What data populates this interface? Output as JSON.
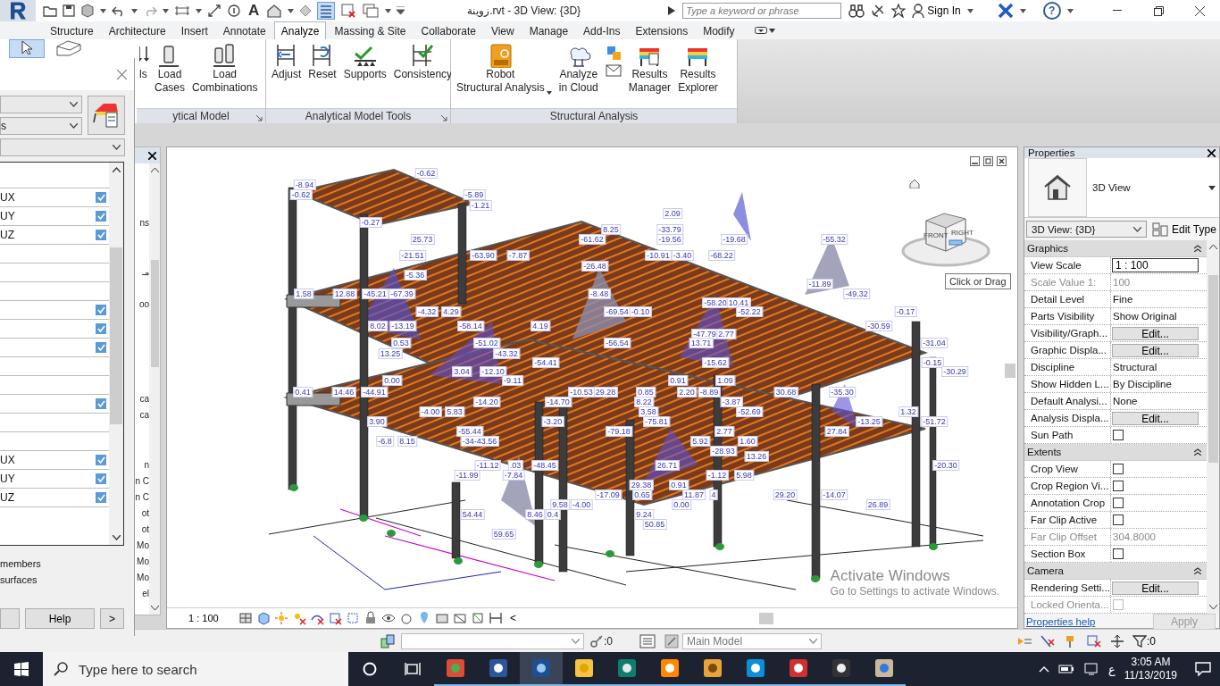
{
  "title_bar": {
    "text_tool": "A",
    "title": "زوينة.rvt - 3D View: {3D}",
    "search": {
      "placeholder": "Type a keyword or phrase"
    },
    "sign_in": "Sign In",
    "help": "?"
  },
  "tabs": [
    {
      "label": "Structure",
      "selected": false
    },
    {
      "label": "Architecture",
      "selected": false
    },
    {
      "label": "Insert",
      "selected": false
    },
    {
      "label": "Annotate",
      "selected": false
    },
    {
      "label": "Analyze",
      "selected": true
    },
    {
      "label": "Massing & Site",
      "selected": false
    },
    {
      "label": "Collaborate",
      "selected": false
    },
    {
      "label": "View",
      "selected": false
    },
    {
      "label": "Manage",
      "selected": false
    },
    {
      "label": "Add-Ins",
      "selected": false
    },
    {
      "label": "Extensions",
      "selected": false
    },
    {
      "label": "Modify",
      "selected": false
    }
  ],
  "ribbon": {
    "groups": [
      {
        "label": "ytical Model",
        "buttons": [
          {
            "kind": "loads",
            "label": "ls"
          },
          {
            "kind": "load-cases",
            "label": "Load\nCases"
          },
          {
            "kind": "load-combinations",
            "label": "Load\nCombinations"
          }
        ]
      },
      {
        "label": "Analytical Model Tools",
        "buttons": [
          {
            "kind": "adjust",
            "label": "Adjust"
          },
          {
            "kind": "reset",
            "label": "Reset"
          },
          {
            "kind": "supports",
            "label": "Supports"
          },
          {
            "kind": "consistency",
            "label": "Consistency"
          }
        ]
      },
      {
        "label": "Structural Analysis",
        "buttons": [
          {
            "kind": "robot",
            "label": "Robot\nStructural Analysis"
          },
          {
            "kind": "cloud",
            "label": "Analyze\nin Cloud"
          },
          {
            "kind": "mini"
          },
          {
            "kind": "results-manager",
            "label": "Results\nManager"
          },
          {
            "kind": "results-explorer",
            "label": "Results\nExplorer"
          }
        ]
      }
    ]
  },
  "dialog": {
    "dropdown_2": "s",
    "rows": [
      {
        "kind": "plain"
      },
      {
        "kind": "check",
        "label": "UX",
        "checked": true
      },
      {
        "kind": "check",
        "label": "UY",
        "checked": true
      },
      {
        "kind": "check",
        "label": "UZ",
        "checked": true
      },
      {
        "kind": "plain"
      },
      {
        "kind": "plain"
      },
      {
        "kind": "plain"
      },
      {
        "kind": "check",
        "checked": true
      },
      {
        "kind": "check",
        "checked": true
      },
      {
        "kind": "check",
        "checked": true
      },
      {
        "kind": "plain"
      },
      {
        "kind": "plain"
      },
      {
        "kind": "check",
        "checked": true
      },
      {
        "kind": "plain"
      },
      {
        "kind": "plain"
      },
      {
        "kind": "check",
        "label": "UX",
        "checked": true
      },
      {
        "kind": "check",
        "label": "UY",
        "checked": true
      },
      {
        "kind": "check",
        "label": "UZ",
        "checked": true
      }
    ],
    "options": [
      "members",
      "surfaces"
    ],
    "help": "Help",
    "next": ">"
  },
  "project_browser": {
    "items": [
      "ns",
      "مـ",
      "oo",
      "ca",
      "ca",
      "n",
      "n C",
      "n C",
      "ot",
      "ot",
      "Mo",
      "Mo",
      "Mo",
      "el"
    ]
  },
  "view": {
    "cube_faces": [
      "FRONT",
      "RIGHT"
    ],
    "tooltip": "Click or Drag",
    "scale": "1 : 100",
    "scroll_left": "<",
    "labels": [
      "-0.62",
      "-8.94",
      "-0.62",
      "-5.89",
      "-1.21",
      "2.09",
      "-0.27",
      "8.25",
      "-33.79",
      "25.73",
      "-61.62",
      "-19.56",
      "-19.68",
      "-55.32",
      "-21.51",
      "-63.90",
      "-7.87",
      "-10.91",
      "-3.40",
      "-68.22",
      "-26.48",
      "-5.36",
      "-11.89",
      "1.58",
      "12.88",
      "-45.21",
      "-67.39",
      "-8.48",
      "-49.32",
      "-58.20",
      "10.41",
      "-4.32",
      "4.29",
      "-69.54",
      "-0.10",
      "-52.22",
      "-0.17",
      "8.02",
      "-13.19",
      "-58.14",
      "4.19",
      "-30.59",
      "-47.79",
      "2.77",
      "0.53",
      "-51.02",
      "-56.54",
      "13.71",
      "-31.04",
      "13.25",
      "-43.32",
      "-54.41",
      "-15.62",
      "-0.15",
      "3.04",
      "-12.10",
      "-30.29",
      "0.00",
      "-9.11",
      "0.91",
      "1.09",
      "0.41",
      "14.46",
      "-44.91",
      "-10.53",
      "29.28",
      "0.85",
      "2.20",
      "-8.89",
      "30.68",
      "-35.30",
      "-14.20",
      "-14.70",
      "8.22",
      "-3.87",
      "-4.00",
      "5.83",
      "3.58",
      "-52.69",
      "1.32",
      "3.90",
      "-3.20",
      "-75.81",
      "-13.25",
      "-51.72",
      "-55.44",
      "-79.18",
      "2.77",
      "27.84",
      "-6.8",
      "8.15",
      "-34-43.56",
      "5.92",
      "1.60",
      "-28.93",
      "13.26",
      "-11.12",
      ".03",
      "-48.45",
      "26.71",
      "-20.30",
      "-11.99",
      "-7.84",
      "-1.12",
      "5.98",
      "29.38",
      "0.91",
      "-17.09",
      "0.65",
      "11.87",
      "4",
      "29.20",
      "-14.07",
      "9.58",
      "-4.00",
      "0.00",
      "26.89",
      "54.44",
      "8.46",
      "0.4",
      "9.24",
      "50.85",
      "59.65"
    ],
    "watermark": {
      "title": "Activate Windows",
      "subtitle": "Go to Settings to activate Windows."
    }
  },
  "properties": {
    "title": "Properties",
    "type_name": "3D View",
    "selector": "3D View: {3D}",
    "edit_type": "Edit Type",
    "sections": [
      {
        "name": "Graphics",
        "rows": [
          {
            "kind": "input",
            "label": "View Scale",
            "value": "1 : 100",
            "disabled": false
          },
          {
            "kind": "text",
            "label": "Scale Value 1:",
            "value": "100",
            "disabled": true
          },
          {
            "kind": "text",
            "label": "Detail Level",
            "value": "Fine",
            "disabled": false
          },
          {
            "kind": "text",
            "label": "Parts Visibility",
            "value": "Show Original",
            "disabled": false
          },
          {
            "kind": "button",
            "label": "Visibility/Graph...",
            "value": "Edit...",
            "disabled": false
          },
          {
            "kind": "button",
            "label": "Graphic Displa...",
            "value": "Edit...",
            "disabled": false
          },
          {
            "kind": "text",
            "label": "Discipline",
            "value": "Structural",
            "disabled": false
          },
          {
            "kind": "text",
            "label": "Show Hidden L...",
            "value": "By Discipline",
            "disabled": false
          },
          {
            "kind": "text",
            "label": "Default Analysi...",
            "value": "None",
            "disabled": false
          },
          {
            "kind": "button",
            "label": "Analysis Displa...",
            "value": "Edit...",
            "disabled": false
          },
          {
            "kind": "checkbox",
            "label": "Sun Path",
            "checked": false,
            "disabled": false
          }
        ]
      },
      {
        "name": "Extents",
        "rows": [
          {
            "kind": "checkbox",
            "label": "Crop View",
            "checked": false,
            "disabled": false
          },
          {
            "kind": "checkbox",
            "label": "Crop Region Vi...",
            "checked": false,
            "disabled": false
          },
          {
            "kind": "checkbox",
            "label": "Annotation Crop",
            "checked": false,
            "disabled": false
          },
          {
            "kind": "checkbox",
            "label": "Far Clip Active",
            "checked": false,
            "disabled": false
          },
          {
            "kind": "text",
            "label": "Far Clip Offset",
            "value": "304.8000",
            "disabled": true
          },
          {
            "kind": "checkbox",
            "label": "Section Box",
            "checked": false,
            "disabled": false
          }
        ]
      },
      {
        "name": "Camera",
        "rows": [
          {
            "kind": "button",
            "label": "Rendering Setti...",
            "value": "Edit...",
            "disabled": false
          },
          {
            "kind": "checkbox",
            "label": "Locked Orienta...",
            "checked": false,
            "disabled": true
          }
        ]
      }
    ],
    "help_link": "Properties help",
    "apply": {
      "label": "Apply",
      "disabled": true
    }
  },
  "status_bar": {
    "worksets_count": ":0",
    "model": "Main Model",
    "filter_count": ":0"
  },
  "taskbar": {
    "search_placeholder": "Type here to search",
    "apps": [
      {
        "kind": "chrome",
        "selected": false
      },
      {
        "kind": "word",
        "selected": false
      },
      {
        "kind": "revit",
        "selected": true
      },
      {
        "kind": "explorer",
        "selected": false
      },
      {
        "kind": "autocad",
        "selected": false
      },
      {
        "kind": "vlc",
        "selected": false
      },
      {
        "kind": "slides",
        "selected": false
      },
      {
        "kind": "transfer",
        "selected": false
      },
      {
        "kind": "sketchup",
        "selected": false
      },
      {
        "kind": "calculator",
        "selected": false
      },
      {
        "kind": "paint",
        "selected": false
      }
    ],
    "language": "ع",
    "time": "3:05 AM",
    "date": "11/13/2019"
  }
}
